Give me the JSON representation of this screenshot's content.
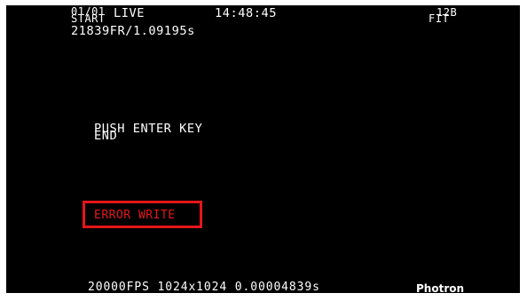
{
  "status_bar": {
    "frame_counter": "01/01",
    "mode": "LIVE",
    "time": "14:48:45",
    "start_label": "START",
    "frame_info": "21839FR/1.09195s",
    "bit_depth": "12B",
    "fit_label": "FIT"
  },
  "prompt": {
    "line1": "PUSH ENTER KEY",
    "line2": "END"
  },
  "error": {
    "message": "ERROR WRITE",
    "color": "#e4161b",
    "highlight_color": "#e4161b"
  },
  "footer": {
    "recording_info": "20000FPS 1024x1024 0.00004839s",
    "brand": "Photron"
  }
}
